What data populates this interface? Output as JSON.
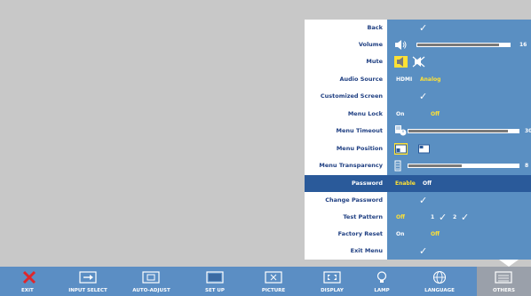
{
  "menu": {
    "rows": [
      {
        "label": "Back"
      },
      {
        "label": "Volume",
        "value": "16",
        "level": 0.88
      },
      {
        "label": "Mute"
      },
      {
        "label": "Audio Source",
        "opt1": "HDMI",
        "opt2": "Analog"
      },
      {
        "label": "Customized Screen"
      },
      {
        "label": "Menu Lock",
        "opt1": "On",
        "opt2": "Off"
      },
      {
        "label": "Menu Timeout",
        "value": "30",
        "level": 0.9
      },
      {
        "label": "Menu Position"
      },
      {
        "label": "Menu Transparency",
        "value": "8",
        "level": 0.48
      },
      {
        "label": "Password",
        "opt1": "Enable",
        "opt2": "Off"
      },
      {
        "label": "Change Password"
      },
      {
        "label": "Test Pattern",
        "opt1": "Off",
        "opt2": "1",
        "opt3": "2"
      },
      {
        "label": "Factory Reset",
        "opt1": "On",
        "opt2": "Off"
      },
      {
        "label": "Exit Menu"
      }
    ],
    "check_glyph": "✓"
  },
  "toolbar": {
    "items": [
      {
        "label": "EXIT",
        "icon": "close-icon"
      },
      {
        "label": "INPUT SELECT",
        "icon": "input-select-icon"
      },
      {
        "label": "AUTO-ADJUST",
        "icon": "auto-adjust-icon"
      },
      {
        "label": "SET UP",
        "icon": "setup-icon"
      },
      {
        "label": "PICTURE",
        "icon": "picture-icon"
      },
      {
        "label": "DISPLAY",
        "icon": "display-icon"
      },
      {
        "label": "LAMP",
        "icon": "lamp-icon"
      },
      {
        "label": "LANGUAGE",
        "icon": "language-icon"
      },
      {
        "label": "OTHERS",
        "icon": "others-icon"
      }
    ]
  },
  "colors": {
    "label_text": "#1f3f82",
    "value_bg": "#5a8fc2",
    "selected_row": "#2a5a9a",
    "highlight": "#ffe135",
    "toolbar_bg": "#5b8ec4",
    "exit_red": "#e0262b"
  }
}
